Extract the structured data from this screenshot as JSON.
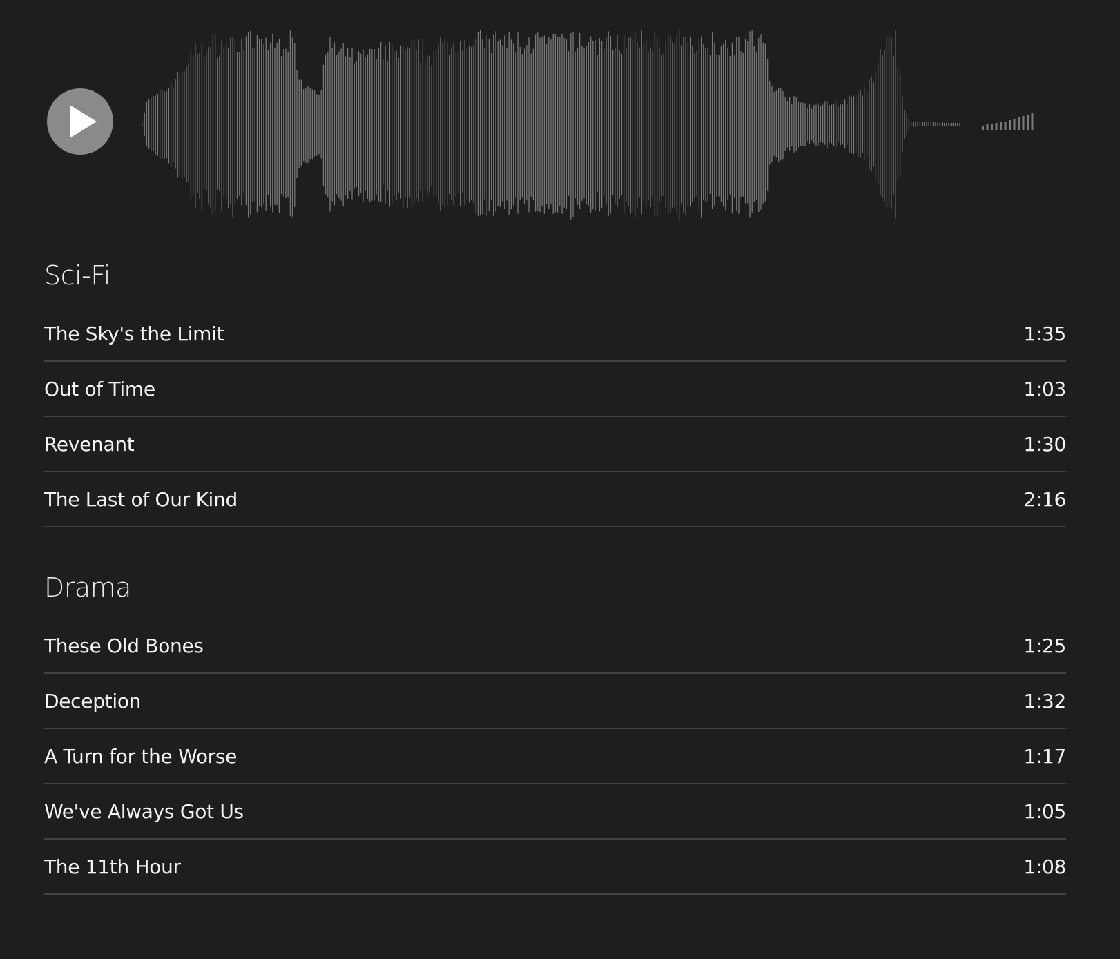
{
  "player": {
    "play_icon": "play-icon",
    "colors": {
      "background": "#1e1e1e",
      "button": "#8a8a8a",
      "waveform": "#7a7a7a",
      "divider": "#444444"
    }
  },
  "sections": [
    {
      "title": "Sci-Fi",
      "tracks": [
        {
          "title": "The Sky's the Limit",
          "duration": "1:35"
        },
        {
          "title": "Out of Time",
          "duration": "1:03"
        },
        {
          "title": "Revenant",
          "duration": "1:30"
        },
        {
          "title": "The Last of Our Kind",
          "duration": "2:16"
        }
      ]
    },
    {
      "title": "Drama",
      "tracks": [
        {
          "title": "These Old Bones",
          "duration": "1:25"
        },
        {
          "title": "Deception",
          "duration": "1:32"
        },
        {
          "title": "A Turn for the Worse",
          "duration": "1:17"
        },
        {
          "title": "We've Always Got Us",
          "duration": "1:05"
        },
        {
          "title": "The 11th Hour",
          "duration": "1:08"
        }
      ]
    }
  ]
}
